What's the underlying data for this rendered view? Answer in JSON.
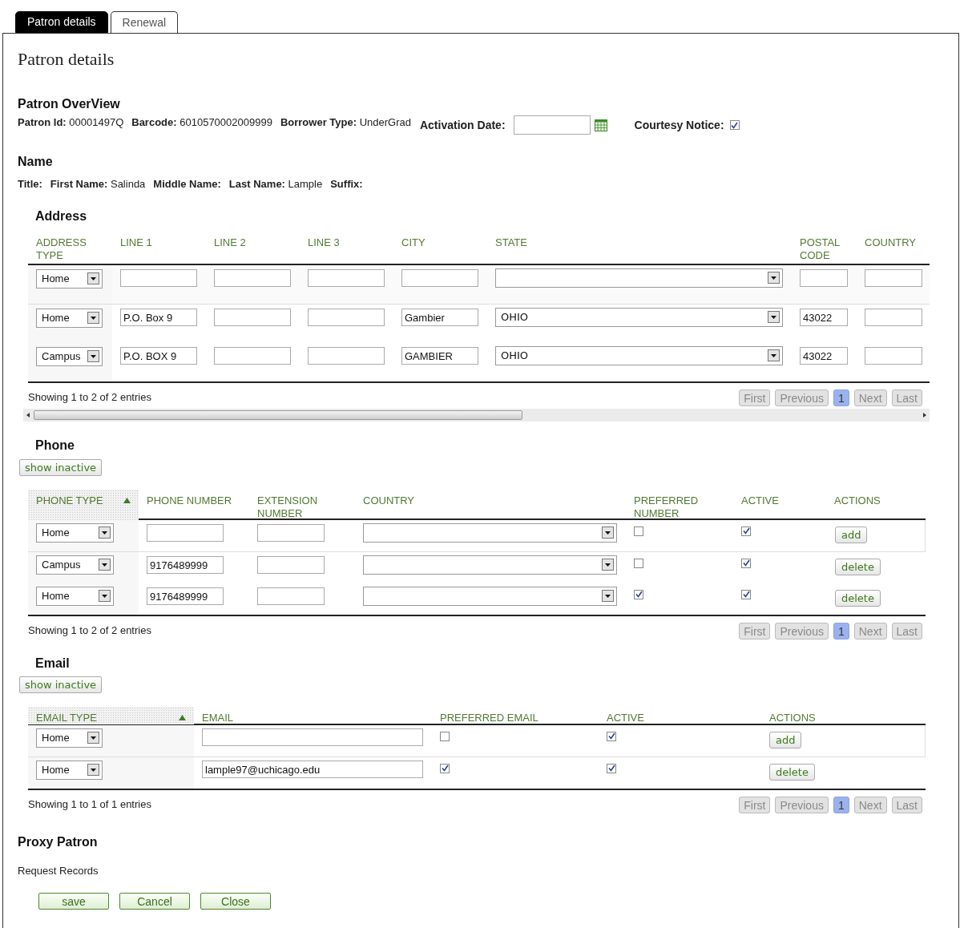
{
  "tabs": [
    {
      "label": "Patron details",
      "selected": true
    },
    {
      "label": "Renewal",
      "selected": false
    }
  ],
  "page_title": "Patron details",
  "overview": {
    "heading": "Patron OverView",
    "fields": [
      {
        "label": "Patron Id:",
        "value": "00001497Q"
      },
      {
        "label": "Barcode:",
        "value": "6010570002009999"
      },
      {
        "label": "Borrower Type:",
        "value": "UnderGrad"
      }
    ],
    "activation_label": "Activation Date:",
    "courtesy": {
      "label": "Courtesy Notice:",
      "checked": true
    }
  },
  "name": {
    "heading": "Name",
    "fields": [
      {
        "label": "Title:"
      },
      {
        "label": "First Name:",
        "value": "Salinda"
      },
      {
        "label": "Middle Name:"
      },
      {
        "label": "Last Name:",
        "value": "Lample"
      },
      {
        "label": "Suffix:"
      }
    ]
  },
  "address": {
    "heading": "Address",
    "columns": [
      "ADDRESS TYPE",
      "LINE 1",
      "LINE 2",
      "LINE 3",
      "CITY",
      "STATE",
      "POSTAL CODE",
      "COUNTRY"
    ],
    "rows": [
      {
        "kind": "new",
        "address_type": "Home"
      },
      {
        "kind": "entry",
        "address_type": "Home",
        "line_1": "P.O. Box 9",
        "city": "Gambier",
        "state": "OHIO",
        "postal_code": "43022"
      },
      {
        "kind": "entry",
        "address_type": "Campus",
        "line_1": "P.O. BOX 9",
        "city": "GAMBIER",
        "state": "OHIO",
        "postal_code": "43022"
      }
    ],
    "info": "Showing 1 to 2 of 2 entries",
    "pager": [
      {
        "kind": "nav",
        "label": "First",
        "disabled": true
      },
      {
        "kind": "nav",
        "label": "Previous",
        "disabled": true
      },
      {
        "kind": "page",
        "label": "1",
        "selected": true
      },
      {
        "kind": "nav",
        "label": "Next",
        "disabled": true
      },
      {
        "kind": "nav",
        "label": "Last",
        "disabled": true
      }
    ]
  },
  "phone": {
    "heading": "Phone",
    "show_inactive": "show inactive",
    "columns": [
      {
        "label": "PHONE TYPE",
        "sorted": true
      },
      {
        "label": "PHONE NUMBER",
        "sorted": false
      },
      {
        "label": "EXTENSION NUMBER",
        "sorted": false
      },
      {
        "label": "COUNTRY",
        "sorted": false
      },
      {
        "label": "PREFERRED NUMBER",
        "sorted": false
      },
      {
        "label": "ACTIVE",
        "sorted": false
      },
      {
        "label": "ACTIONS",
        "sorted": false
      }
    ],
    "rows": [
      {
        "kind": "new",
        "phone_type": "Home",
        "preferred": false,
        "active": true,
        "action": "add"
      },
      {
        "kind": "entry",
        "phone_type": "Campus",
        "phone_number": "9176489999",
        "preferred": false,
        "active": true,
        "action": "delete"
      },
      {
        "kind": "entry",
        "phone_type": "Home",
        "phone_number": "9176489999",
        "preferred": true,
        "active": true,
        "action": "delete"
      }
    ],
    "info": "Showing 1 to 2 of 2 entries",
    "pager": [
      {
        "kind": "nav",
        "label": "First",
        "disabled": true
      },
      {
        "kind": "nav",
        "label": "Previous",
        "disabled": true
      },
      {
        "kind": "page",
        "label": "1",
        "selected": true
      },
      {
        "kind": "nav",
        "label": "Next",
        "disabled": true
      },
      {
        "kind": "nav",
        "label": "Last",
        "disabled": true
      }
    ]
  },
  "email": {
    "heading": "Email",
    "show_inactive": "show inactive",
    "columns": [
      {
        "label": "EMAIL TYPE",
        "sorted": true
      },
      {
        "label": "EMAIL",
        "sorted": false
      },
      {
        "label": "PREFERRED EMAIL",
        "sorted": false
      },
      {
        "label": "ACTIVE",
        "sorted": false
      },
      {
        "label": "ACTIONS",
        "sorted": false
      }
    ],
    "rows": [
      {
        "kind": "new",
        "email_type": "Home",
        "preferred": false,
        "active": true,
        "action": "add"
      },
      {
        "kind": "entry",
        "email_type": "Home",
        "email": "lample97@uchicago.edu",
        "preferred": true,
        "active": true,
        "action": "delete"
      }
    ],
    "info": "Showing 1 to 1 of 1 entries",
    "pager": [
      {
        "kind": "nav",
        "label": "First",
        "disabled": true
      },
      {
        "kind": "nav",
        "label": "Previous",
        "disabled": true
      },
      {
        "kind": "page",
        "label": "1",
        "selected": true
      },
      {
        "kind": "nav",
        "label": "Next",
        "disabled": true
      },
      {
        "kind": "nav",
        "label": "Last",
        "disabled": true
      }
    ]
  },
  "proxy": {
    "heading": "Proxy Patron",
    "text": "Request Records"
  },
  "buttons": [
    "save",
    "Cancel",
    "Close"
  ]
}
